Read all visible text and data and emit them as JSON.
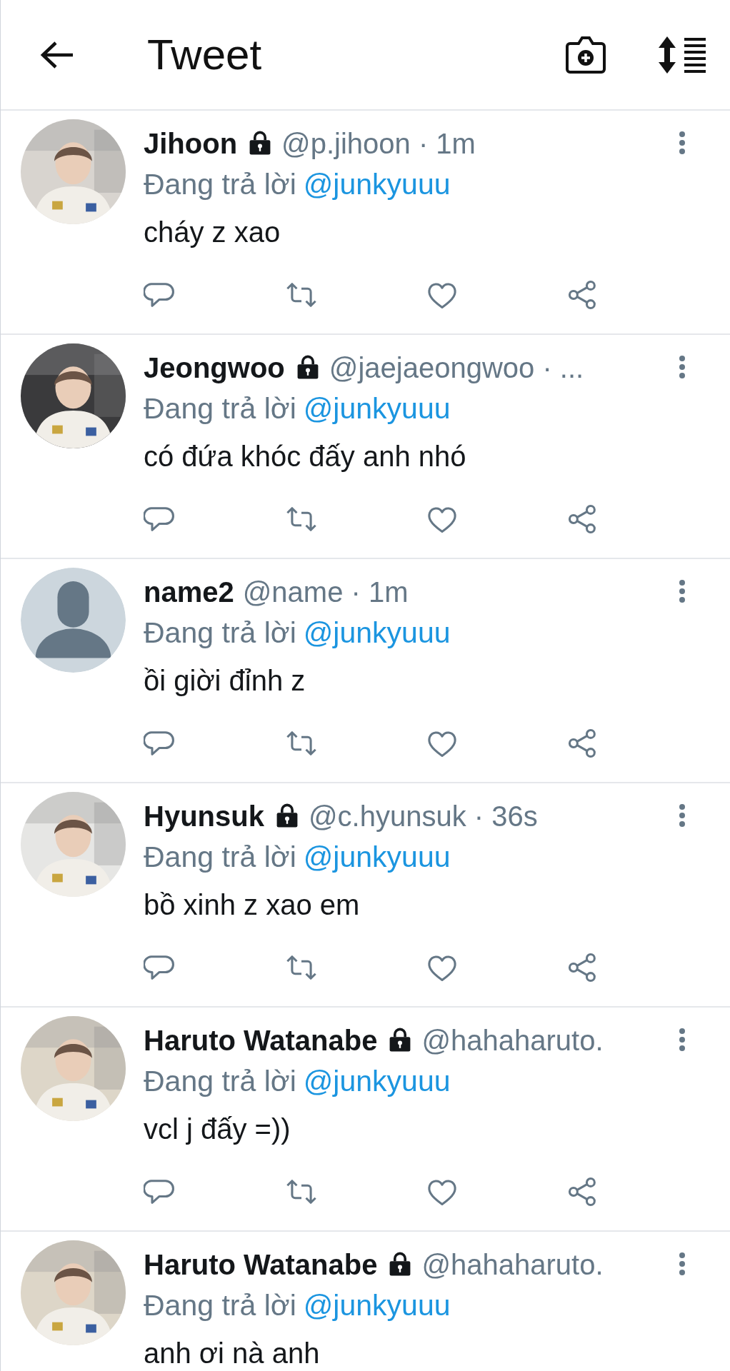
{
  "header": {
    "title": "Tweet"
  },
  "tweets": [
    {
      "name": "Jihoon",
      "protected": true,
      "meta": "@p.jihoon · 1m",
      "reply_label": "Đang trả lời",
      "reply_to": "@junkyuuu",
      "text": "cháy z xao"
    },
    {
      "name": "Jeongwoo",
      "protected": true,
      "meta": "@jaejaeongwoo · ...",
      "reply_label": "Đang trả lời",
      "reply_to": "@junkyuuu",
      "text": "có đứa khóc đấy anh nhó"
    },
    {
      "avatar": {
        "kind": "default",
        "color": "#ccd6dd"
      },
      "name": "name2",
      "protected": false,
      "meta": "@name · 1m",
      "reply_label": "Đang trả lời",
      "reply_to": "@junkyuuu",
      "text": "ồi giời đỉnh z"
    },
    {
      "name": "Hyunsuk",
      "protected": true,
      "meta": "@c.hyunsuk · 36s",
      "reply_label": "Đang trả lời",
      "reply_to": "@junkyuuu",
      "text": "bồ xinh z xao em"
    },
    {
      "name": "Haruto Watanabe",
      "protected": true,
      "meta": "@hahaharuto.",
      "reply_label": "Đang trả lời",
      "reply_to": "@junkyuuu",
      "text": "vcl j đấy =))"
    },
    {
      "name": "Haruto Watanabe",
      "protected": true,
      "meta": "@hahaharuto.",
      "reply_label": "Đang trả lời",
      "reply_to": "@junkyuuu",
      "text": "anh ơi nà anh"
    }
  ]
}
